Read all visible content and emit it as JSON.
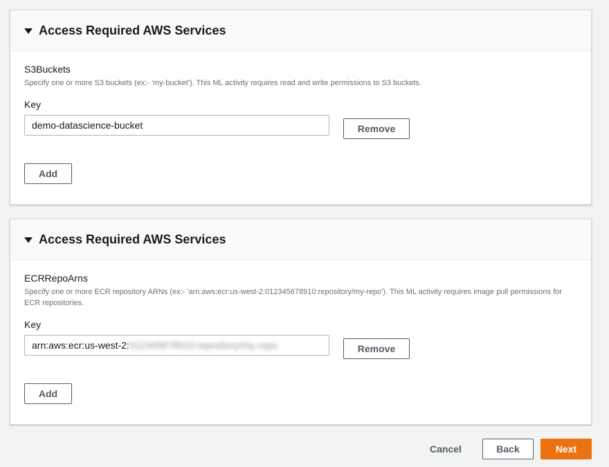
{
  "panels": [
    {
      "title": "Access Required AWS Services",
      "field_label": "S3Buckets",
      "description": "Specify one or more S3 buckets (ex:- 'my-bucket'). This ML activity requires read and write permissions to S3 buckets.",
      "key_label": "Key",
      "input_value": "demo-datascience-bucket",
      "remove_label": "Remove",
      "add_label": "Add"
    },
    {
      "title": "Access Required AWS Services",
      "field_label": "ECRRepoArns",
      "description": "Specify one or more ECR repository ARNs (ex:- 'arn:aws:ecr:us-west-2:012345678910:repository/my-repo'). This ML activity requires image pull permissions for ECR repositories.",
      "key_label": "Key",
      "input_value_visible": "arn:aws:ecr:us-west-2:",
      "input_value_redacted": "012345678910:repository/my-repo",
      "remove_label": "Remove",
      "add_label": "Add"
    }
  ],
  "footer": {
    "cancel_label": "Cancel",
    "back_label": "Back",
    "next_label": "Next"
  },
  "colors": {
    "primary": "#ec7211",
    "text": "#16191f",
    "secondary_text": "#687078",
    "border": "#545b64"
  }
}
